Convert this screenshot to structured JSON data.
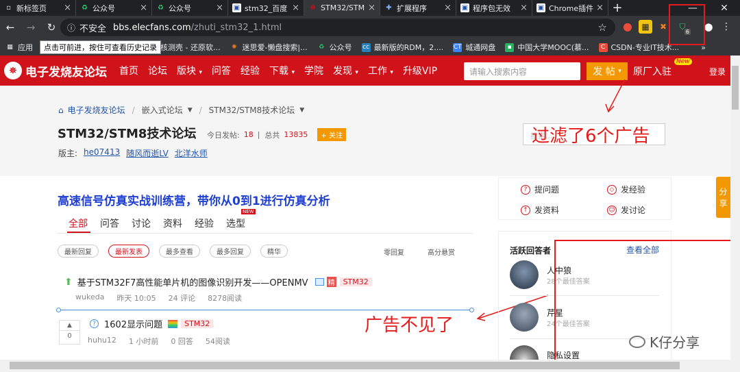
{
  "browser": {
    "tabs": [
      {
        "title": "新标签页",
        "icon": "blank-page-icon"
      },
      {
        "title": "公众号",
        "icon": "wechat-icon"
      },
      {
        "title": "公众号",
        "icon": "wechat-icon"
      },
      {
        "title": "stm32_百度",
        "icon": "elecfans-icon"
      },
      {
        "title": "STM32/STM",
        "icon": "elecfans-icon"
      },
      {
        "title": "扩展程序",
        "icon": "puzzle-icon"
      },
      {
        "title": "程序包无效",
        "icon": "elecfans-icon"
      },
      {
        "title": "Chrome插件",
        "icon": "elecfans-icon"
      }
    ],
    "new_tab": "+",
    "security": "不安全",
    "url_host": "bbs.elecfans.com",
    "url_path": "/zhuti_stm32_1.html",
    "ext_badge": "6",
    "tooltip": "点击可前进，按住可查看历史记录",
    "bookmarks": [
      {
        "label": "应用",
        "icon": "apps-icon",
        "color": "#e8eaed"
      },
      {
        "label": "核测壳 - 还原软...",
        "icon": "blank-page-icon",
        "color": "#aaaaaa"
      },
      {
        "label": "迷思爱-懒盘搜索|...",
        "icon": "gear-icon",
        "color": "#e67e22"
      },
      {
        "label": "公众号",
        "icon": "wechat-icon",
        "color": "#2ecc71"
      },
      {
        "label": "最新版的RDM，2....",
        "icon": "cc-icon",
        "color": "#2980b9"
      },
      {
        "label": "城通网盘",
        "icon": "ct-icon",
        "color": "#3b82f6"
      },
      {
        "label": "中国大学MOOC(慕...",
        "icon": "mooc-icon",
        "color": "#27ae60"
      },
      {
        "label": "CSDN-专业IT技术...",
        "icon": "csdn-icon",
        "color": "#e74c3c"
      }
    ]
  },
  "site": {
    "logo": "电子发烧友论坛",
    "nav": [
      "首页",
      "论坛",
      "版块",
      "问答",
      "经验",
      "下载",
      "学院",
      "发现",
      "工作",
      "升级VIP"
    ],
    "search_placeholder": "请输入搜索内容",
    "post_btn": "发 帖",
    "yuanchang": "原厂入驻",
    "new_badge": "New",
    "login": "登录"
  },
  "forum": {
    "crumbs": [
      "电子发烧友论坛",
      "嵌入式论坛",
      "STM32/STM8技术论坛"
    ],
    "title": "STM32/STM8技术论坛",
    "today_label": "今日发帖:",
    "today_count": "18",
    "total_label": "总共",
    "total_count": "13835",
    "follow": "+ 关注",
    "mods_label": "版主:",
    "mods": [
      "he07413",
      "随风而逝LV",
      "北洋水师"
    ],
    "ad_faint": "搜索..."
  },
  "annotations": {
    "filtered": "过滤了6个广告",
    "ad_gone": "广告不见了"
  },
  "main": {
    "banner": "高速信号仿真实战训练营，带你从0到1进行仿真分析",
    "tabs": [
      "全部",
      "问答",
      "讨论",
      "资料",
      "经验",
      "选型"
    ],
    "tab_new": "NEW",
    "filters": [
      "最新回复",
      "最新发表",
      "最多查看",
      "最多回复",
      "精华"
    ],
    "right_filters": [
      "零回复",
      "高分悬赏"
    ],
    "post1": {
      "title": "基于STM32F7高性能单片机的图像识别开发——OPENMV",
      "jing": "精",
      "tag": "STM32",
      "author": "wukeda",
      "time": "昨天 10:05",
      "comments": "24 评论",
      "reads": "8278阅读"
    },
    "post2": {
      "votes": "0",
      "title": "1602显示问题",
      "tag": "STM32",
      "author": "huhu12",
      "time": "1 小时前",
      "answers": "0 回答",
      "reads": "54阅读"
    }
  },
  "sidebar": {
    "actions": [
      {
        "label": "提问题",
        "icon": "question-icon"
      },
      {
        "label": "发经验",
        "icon": "diamond-icon"
      },
      {
        "label": "发资料",
        "icon": "upload-icon"
      },
      {
        "label": "发讨论",
        "icon": "chat-icon"
      }
    ],
    "active_title": "活跃回答者",
    "view_all": "查看全部",
    "answerers": [
      {
        "name": "人中狼",
        "count": "28个最佳答案"
      },
      {
        "name": "芹星",
        "count": "24个最佳答案"
      },
      {
        "name": "隐私设置",
        "count": ""
      }
    ],
    "share": [
      "分",
      "享"
    ]
  },
  "watermark": "K仔分享",
  "colors": {
    "brand_red": "#d0121b",
    "orange": "#f39800",
    "annotation_red": "#e51b1b"
  }
}
